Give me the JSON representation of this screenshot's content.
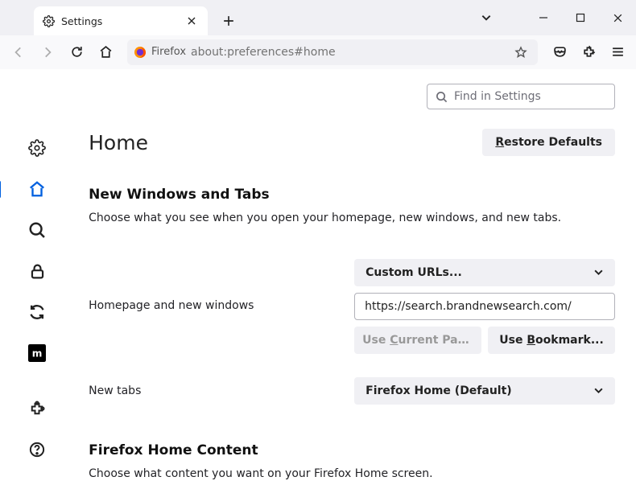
{
  "tab": {
    "title": "Settings"
  },
  "urlbar": {
    "identity_label": "Firefox",
    "url": "about:preferences#home"
  },
  "search_settings": {
    "placeholder": "Find in Settings"
  },
  "page": {
    "title": "Home",
    "restore_btn": "Restore Defaults",
    "section1_title": "New Windows and Tabs",
    "section1_sub": "Choose what you see when you open your homepage, new windows, and new tabs.",
    "homepage_label": "Homepage and new windows",
    "homepage_dropdown": "Custom URLs...",
    "homepage_url": "https://search.brandnewsearch.com/",
    "use_current": "Use Current Pages",
    "use_bookmark": "Use Bookmark...",
    "newtabs_label": "New tabs",
    "newtabs_dropdown": "Firefox Home (Default)",
    "section2_title": "Firefox Home Content",
    "section2_sub": "Choose what content you want on your Firefox Home screen."
  }
}
